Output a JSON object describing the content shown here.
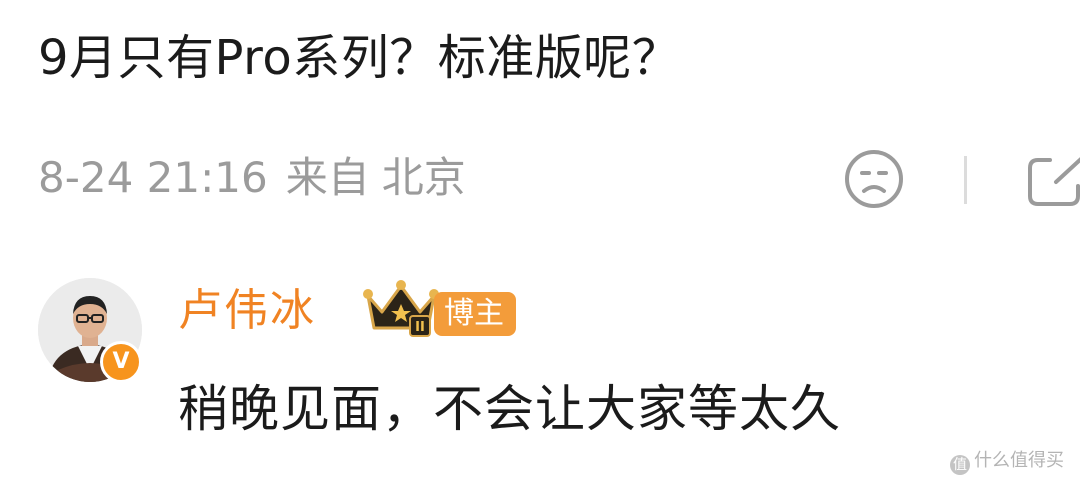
{
  "post": {
    "text": "9月只有Pro系列？标准版呢？",
    "time": "8-24 21:16",
    "source_prefix": "来自",
    "location": "北京"
  },
  "actions": {
    "like_icon": "sad-face-icon",
    "share_icon": "share-icon"
  },
  "reply": {
    "username": "卢伟冰",
    "verified_mark": "V",
    "level_icon": "crown-icon",
    "level_mark": "II",
    "role_badge": "博主",
    "text": "稍晚见面，不会让大家等太久"
  },
  "watermark": {
    "logo": "值",
    "text": "什么值得买"
  },
  "colors": {
    "primary_text": "#1b1b1b",
    "meta_text": "#9b9b9b",
    "username": "#f08323",
    "badge_bg": "#f39c3a",
    "verified": "#f7941d"
  }
}
